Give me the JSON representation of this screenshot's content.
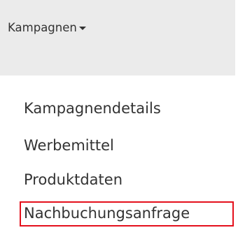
{
  "menu": {
    "toggle_label": "Kampagnen",
    "items": [
      {
        "label": "Kampagnendetails"
      },
      {
        "label": "Werbemittel"
      },
      {
        "label": "Produktdaten"
      },
      {
        "label": "Nachbuchungsanfrage",
        "highlighted": true
      }
    ]
  },
  "colors": {
    "header_background": "#ebebeb",
    "text": "#333333",
    "highlight_border": "#e4101c"
  }
}
